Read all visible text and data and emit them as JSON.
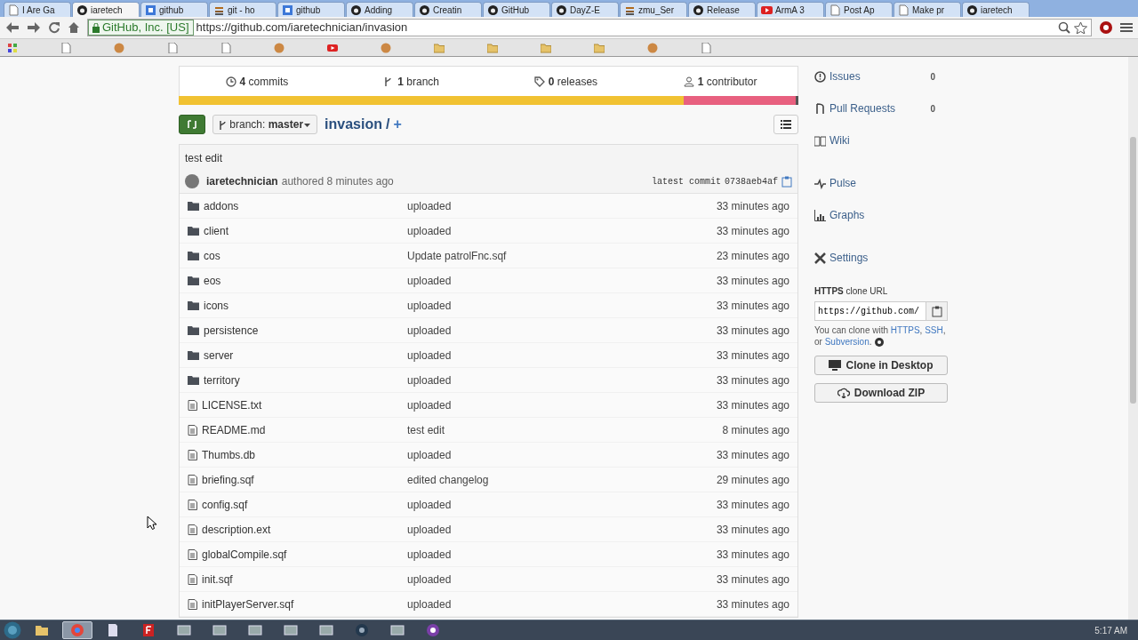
{
  "browser": {
    "tabs": [
      {
        "title": "I Are Ga",
        "kind": "page",
        "selected": false
      },
      {
        "title": "iaretech",
        "kind": "octocat",
        "selected": true
      },
      {
        "title": "github",
        "kind": "search",
        "selected": false
      },
      {
        "title": "git - ho",
        "kind": "stack",
        "selected": false
      },
      {
        "title": "github",
        "kind": "search",
        "selected": false
      },
      {
        "title": "Adding",
        "kind": "octocat",
        "selected": false
      },
      {
        "title": "Creatin",
        "kind": "octocat",
        "selected": false
      },
      {
        "title": "GitHub",
        "kind": "octocat",
        "selected": false
      },
      {
        "title": "DayZ-E",
        "kind": "octocat",
        "selected": false
      },
      {
        "title": "zmu_Ser",
        "kind": "stack",
        "selected": false
      },
      {
        "title": "Release",
        "kind": "octocat",
        "selected": false
      },
      {
        "title": "ArmA 3",
        "kind": "video",
        "selected": false
      },
      {
        "title": "Post Ap",
        "kind": "page",
        "selected": false
      },
      {
        "title": "Make pr",
        "kind": "page",
        "selected": false
      },
      {
        "title": "iaretech",
        "kind": "octocat",
        "selected": false
      }
    ],
    "address": {
      "identity": "GitHub, Inc. [US]",
      "url": "https://github.com/iaretechnician/invasion"
    },
    "bookmarks": [
      {
        "kind": "apps"
      },
      {
        "kind": "page"
      },
      {
        "kind": "site"
      },
      {
        "kind": "page"
      },
      {
        "kind": "page"
      },
      {
        "kind": "site"
      },
      {
        "kind": "video"
      },
      {
        "kind": "site"
      },
      {
        "kind": "folder"
      },
      {
        "kind": "folder"
      },
      {
        "kind": "folder"
      },
      {
        "kind": "folder"
      },
      {
        "kind": "site"
      },
      {
        "kind": "page"
      }
    ]
  },
  "repo": {
    "stats": [
      {
        "kind": "commits",
        "count": "4",
        "label": "commits"
      },
      {
        "kind": "branch",
        "count": "1",
        "label": "branch"
      },
      {
        "kind": "releases",
        "count": "0",
        "label": "releases"
      },
      {
        "kind": "contributors",
        "count": "1",
        "label": "contributor"
      }
    ],
    "language_bar": [
      {
        "color": "#f1c232",
        "level": 0.815
      },
      {
        "color": "#e8607f",
        "level": 0.18
      },
      {
        "color": "#555555",
        "level": 0.005
      }
    ],
    "branch": {
      "label": "branch:",
      "name": "master"
    },
    "breadcrumb": {
      "repo": "invasion",
      "separator": "/",
      "add": "+"
    },
    "last_commit": {
      "message": "test edit",
      "author": "iaretechnician",
      "action": "authored 8 minutes ago",
      "hash_label": "latest commit",
      "hash": "0738aeb4af"
    },
    "files": [
      {
        "kind": "folder",
        "name": "addons",
        "message": "uploaded",
        "age": "33 minutes ago"
      },
      {
        "kind": "folder",
        "name": "client",
        "message": "uploaded",
        "age": "33 minutes ago"
      },
      {
        "kind": "folder",
        "name": "cos",
        "message": "Update patrolFnc.sqf",
        "age": "23 minutes ago"
      },
      {
        "kind": "folder",
        "name": "eos",
        "message": "uploaded",
        "age": "33 minutes ago"
      },
      {
        "kind": "folder",
        "name": "icons",
        "message": "uploaded",
        "age": "33 minutes ago"
      },
      {
        "kind": "folder",
        "name": "persistence",
        "message": "uploaded",
        "age": "33 minutes ago"
      },
      {
        "kind": "folder",
        "name": "server",
        "message": "uploaded",
        "age": "33 minutes ago"
      },
      {
        "kind": "folder",
        "name": "territory",
        "message": "uploaded",
        "age": "33 minutes ago"
      },
      {
        "kind": "file",
        "name": "LICENSE.txt",
        "message": "uploaded",
        "age": "33 minutes ago"
      },
      {
        "kind": "file",
        "name": "README.md",
        "message": "test edit",
        "age": "8 minutes ago"
      },
      {
        "kind": "file",
        "name": "Thumbs.db",
        "message": "uploaded",
        "age": "33 minutes ago"
      },
      {
        "kind": "file",
        "name": "briefing.sqf",
        "message": "edited changelog",
        "age": "29 minutes ago"
      },
      {
        "kind": "file",
        "name": "config.sqf",
        "message": "uploaded",
        "age": "33 minutes ago"
      },
      {
        "kind": "file",
        "name": "description.ext",
        "message": "uploaded",
        "age": "33 minutes ago"
      },
      {
        "kind": "file",
        "name": "globalCompile.sqf",
        "message": "uploaded",
        "age": "33 minutes ago"
      },
      {
        "kind": "file",
        "name": "init.sqf",
        "message": "uploaded",
        "age": "33 minutes ago"
      },
      {
        "kind": "file",
        "name": "initPlayerServer.sqf",
        "message": "uploaded",
        "age": "33 minutes ago"
      }
    ]
  },
  "sidebar": {
    "nav": [
      {
        "kind": "issues",
        "label": "Issues",
        "count": "0"
      },
      {
        "kind": "pulls",
        "label": "Pull Requests",
        "count": "0"
      },
      {
        "kind": "wiki",
        "label": "Wiki"
      },
      {
        "kind": "pulse",
        "label": "Pulse"
      },
      {
        "kind": "graphs",
        "label": "Graphs"
      },
      {
        "kind": "settings",
        "label": "Settings"
      }
    ],
    "clone": {
      "protocol": "HTTPS",
      "title": "clone URL",
      "url": "https://github.com/",
      "note_lines": [
        [
          {
            "text": "You can clone with ",
            "link": false
          },
          {
            "text": "HTTPS",
            "link": true
          },
          {
            "text": ", ",
            "link": false
          },
          {
            "text": "SSH",
            "link": true
          },
          {
            "text": ",",
            "link": false
          }
        ],
        [
          {
            "text": "or ",
            "link": false
          },
          {
            "text": "Subversion",
            "link": true
          },
          {
            "text": ".",
            "link": false
          }
        ]
      ],
      "buttons": [
        {
          "kind": "desktop",
          "label": "Clone in Desktop"
        },
        {
          "kind": "download",
          "label": "Download ZIP"
        }
      ]
    }
  },
  "taskbar": {
    "items": [
      {
        "kind": "folder",
        "active": false
      },
      {
        "kind": "browser",
        "active": true
      },
      {
        "kind": "document",
        "active": false
      },
      {
        "kind": "ftp",
        "active": false
      },
      {
        "kind": "app",
        "active": false
      },
      {
        "kind": "app",
        "active": false
      },
      {
        "kind": "app",
        "active": false
      },
      {
        "kind": "app",
        "active": false
      },
      {
        "kind": "app",
        "active": false
      },
      {
        "kind": "game",
        "active": false
      },
      {
        "kind": "app",
        "active": false
      },
      {
        "kind": "media",
        "active": false
      }
    ],
    "clock": "5:17 AM"
  }
}
